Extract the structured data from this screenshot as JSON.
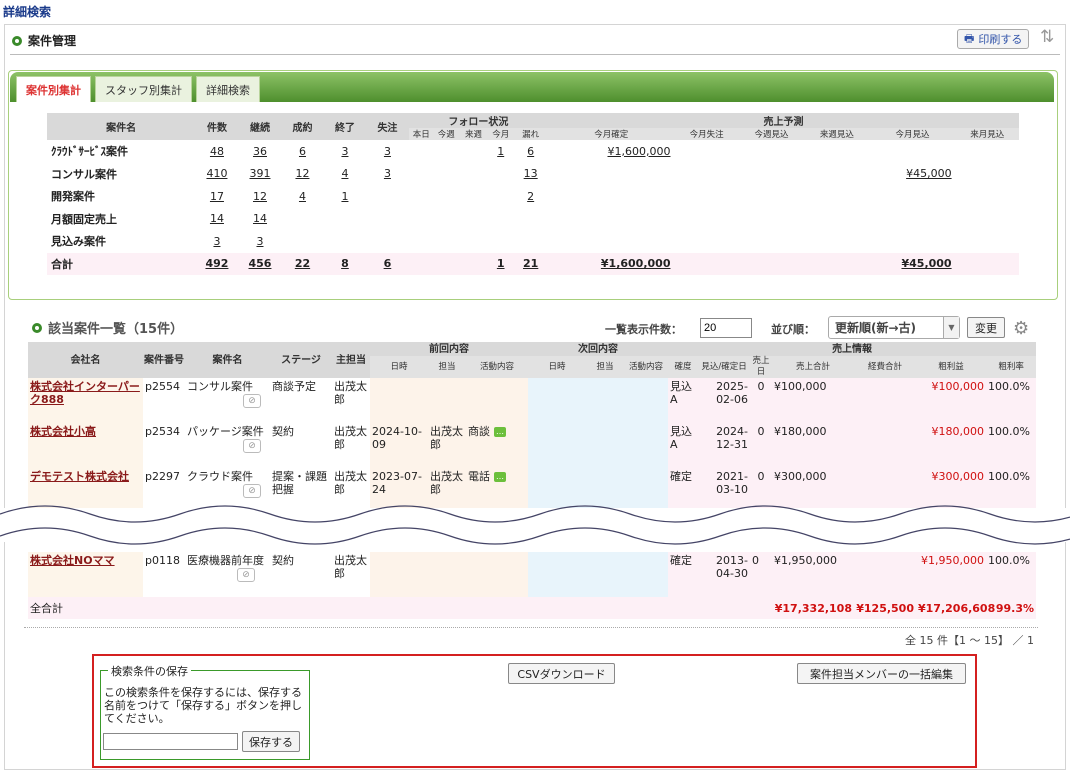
{
  "page_title": "詳細検索",
  "section_title": "案件管理",
  "print_label": "印刷する",
  "tabs": [
    "案件別集計",
    "スタッフ別集計",
    "詳細検索"
  ],
  "summary": {
    "headers": {
      "name": "案件名",
      "count": "件数",
      "continue": "継続",
      "success": "成約",
      "end": "終了",
      "lost": "失注",
      "follow": "フォロー状況",
      "sales": "売上予測"
    },
    "follow_sub": [
      "本日",
      "今週",
      "来週",
      "今月",
      "漏れ"
    ],
    "sales_sub": [
      "今月確定",
      "今月失注",
      "今週見込",
      "来週見込",
      "今月見込",
      "来月見込"
    ],
    "rows": [
      {
        "name": "ｸﾗｳﾄﾞｻｰﾋﾞｽ案件",
        "count": "48",
        "continue": "36",
        "success": "6",
        "end": "3",
        "lost": "3",
        "this_month": "1",
        "missed": "6",
        "fixed": "¥1,600,000",
        "forecast": ""
      },
      {
        "name": "コンサル案件",
        "count": "410",
        "continue": "391",
        "success": "12",
        "end": "4",
        "lost": "3",
        "this_month": "",
        "missed": "13",
        "fixed": "",
        "forecast": "¥45,000"
      },
      {
        "name": "開発案件",
        "count": "17",
        "continue": "12",
        "success": "4",
        "end": "1",
        "lost": "",
        "this_month": "",
        "missed": "2",
        "fixed": "",
        "forecast": ""
      },
      {
        "name": "月額固定売上",
        "count": "14",
        "continue": "14",
        "success": "",
        "end": "",
        "lost": "",
        "this_month": "",
        "missed": "",
        "fixed": "",
        "forecast": ""
      },
      {
        "name": "見込み案件",
        "count": "3",
        "continue": "3",
        "success": "",
        "end": "",
        "lost": "",
        "this_month": "",
        "missed": "",
        "fixed": "",
        "forecast": ""
      }
    ],
    "total": {
      "name": "合計",
      "count": "492",
      "continue": "456",
      "success": "22",
      "end": "8",
      "lost": "6",
      "this_month": "1",
      "missed": "21",
      "fixed": "¥1,600,000",
      "forecast": "¥45,000"
    }
  },
  "list": {
    "title": "該当案件一覧（15件）",
    "display_label": "一覧表示件数：",
    "display_count": "20",
    "sort_label": "並び順：",
    "sort_value": "更新順(新→古)",
    "change_label": "変更",
    "headers": {
      "company": "会社名",
      "case_no": "案件番号",
      "case_name": "案件名",
      "stage": "ステージ",
      "owner": "主担当",
      "prev": "前回内容",
      "next": "次回内容",
      "sales": "売上情報"
    },
    "prev_sub": [
      "日時",
      "担当",
      "活動内容"
    ],
    "next_sub": [
      "日時",
      "担当",
      "活動内容"
    ],
    "sales_sub": [
      "確度",
      "見込/確定日",
      "売上日",
      "売上合計",
      "経費合計",
      "粗利益",
      "粗利率"
    ],
    "rows": [
      {
        "company": "株式会社インターパーク888",
        "no": "p2554",
        "name": "コンサル案件",
        "stage": "商談予定",
        "owner": "出茂太郎",
        "prev_date": "",
        "prev_staff": "",
        "prev_act": "",
        "prob": "見込A",
        "date": "2025-02-06",
        "sales_day": "0",
        "sales": "¥100,000",
        "cost": "",
        "profit": "¥100,000",
        "rate": "100.0%"
      },
      {
        "company": "株式会社小高",
        "no": "p2534",
        "name": "パッケージ案件",
        "stage": "契約",
        "owner": "出茂太郎",
        "prev_date": "2024-10-09",
        "prev_staff": "出茂太郎",
        "prev_act": "商談",
        "prob": "見込A",
        "date": "2024-12-31",
        "sales_day": "0",
        "sales": "¥180,000",
        "cost": "",
        "profit": "¥180,000",
        "rate": "100.0%"
      },
      {
        "company": "デモテスト株式会社",
        "no": "p2297",
        "name": "クラウド案件",
        "stage": "提案・課題把握",
        "owner": "出茂太郎",
        "prev_date": "2023-07-24",
        "prev_staff": "出茂太郎",
        "prev_act": "電話",
        "prob": "確定",
        "date": "2021-03-10",
        "sales_day": "0",
        "sales": "¥300,000",
        "cost": "",
        "profit": "¥300,000",
        "rate": "100.0%"
      }
    ],
    "last_row": {
      "company": "株式会社NOママ",
      "no": "p0118",
      "name": "医療機器前年度",
      "stage": "契約",
      "owner": "出茂太郎",
      "prob": "確定",
      "date": "2013-04-30",
      "sales_day": "0",
      "sales": "¥1,950,000",
      "profit": "¥1,950,000",
      "rate": "100.0%"
    },
    "grand_total": {
      "label": "全合計",
      "sales": "¥17,332,108",
      "cost": "¥125,500",
      "profit": "¥17,206,608",
      "rate": "99.3%"
    },
    "pager": "全 15 件【1 ～ 15】 ／ 1"
  },
  "save_box": {
    "legend": "検索条件の保存",
    "desc": "この検索条件を保存するには、保存する名前をつけて「保存する」ボタンを押してください。",
    "save_label": "保存する"
  },
  "csv_label": "CSVダウンロード",
  "bulk_label": "案件担当メンバーの一括編集"
}
